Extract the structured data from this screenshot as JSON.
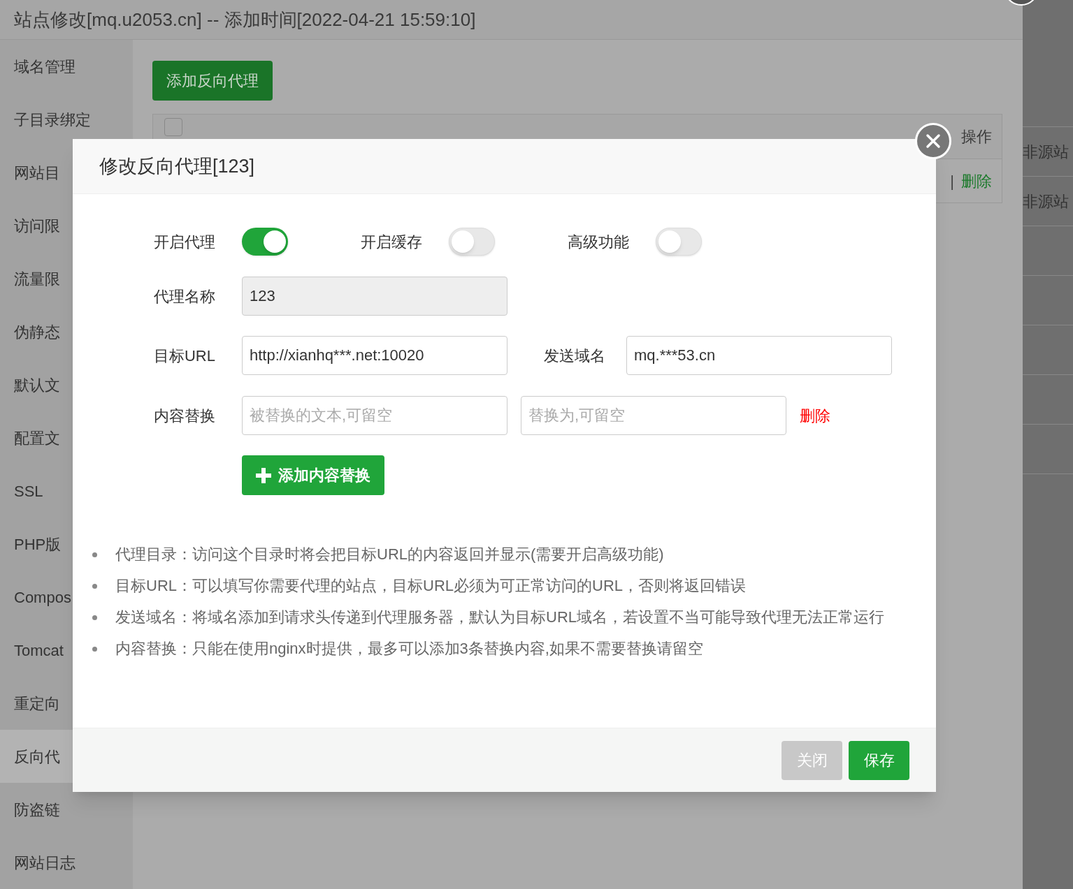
{
  "page": {
    "title": "站点修改[mq.u2053.cn] -- 添加时间[2022-04-21 15:59:10]",
    "sidebar": [
      {
        "label": "域名管理",
        "selected": false
      },
      {
        "label": "子目录绑定",
        "selected": false
      },
      {
        "label": "网站目",
        "selected": false
      },
      {
        "label": "访问限",
        "selected": false
      },
      {
        "label": "流量限",
        "selected": false
      },
      {
        "label": "伪静态",
        "selected": false
      },
      {
        "label": "默认文",
        "selected": false
      },
      {
        "label": "配置文",
        "selected": false
      },
      {
        "label": "SSL",
        "selected": false
      },
      {
        "label": "PHP版",
        "selected": false
      },
      {
        "label": "Compos",
        "selected": false
      },
      {
        "label": "Tomcat",
        "selected": false
      },
      {
        "label": "重定向",
        "selected": false
      },
      {
        "label": "反向代",
        "selected": true
      },
      {
        "label": "防盗链",
        "selected": false
      },
      {
        "label": "网站日志",
        "selected": false
      }
    ],
    "add_button": "添加反向代理",
    "table": {
      "select_all": {
        "checked": false
      },
      "columns": [
        "操作"
      ],
      "row_separator": "|",
      "row_action": "删除"
    },
    "behind_column": [
      "非源站",
      "非源站"
    ]
  },
  "dialog": {
    "title": "修改反向代理[123]",
    "toggles": [
      {
        "label": "开启代理",
        "on": true
      },
      {
        "label": "开启缓存",
        "on": false
      },
      {
        "label": "高级功能",
        "on": false
      }
    ],
    "name": {
      "label": "代理名称",
      "value": "123"
    },
    "target_url": {
      "label": "目标URL",
      "value": "http://xianhq***.net:10020"
    },
    "send_domain": {
      "label": "发送域名",
      "value": "mq.***53.cn"
    },
    "replace": {
      "label": "内容替换",
      "from_placeholder": "被替换的文本,可留空",
      "to_placeholder": "替换为,可留空",
      "delete": "删除"
    },
    "add_replace": "添加内容替换",
    "notes": [
      "代理目录：访问这个目录时将会把目标URL的内容返回并显示(需要开启高级功能)",
      "目标URL：可以填写你需要代理的站点，目标URL必须为可正常访问的URL，否则将返回错误",
      "发送域名：将域名添加到请求头传递到代理服务器，默认为目标URL域名，若设置不当可能导致代理无法正常运行",
      "内容替换：只能在使用nginx时提供，最多可以添加3条替换内容,如果不需要替换请留空"
    ],
    "buttons": [
      {
        "label": "关闭",
        "kind": "secondary"
      },
      {
        "label": "保存",
        "kind": "primary"
      }
    ]
  }
}
